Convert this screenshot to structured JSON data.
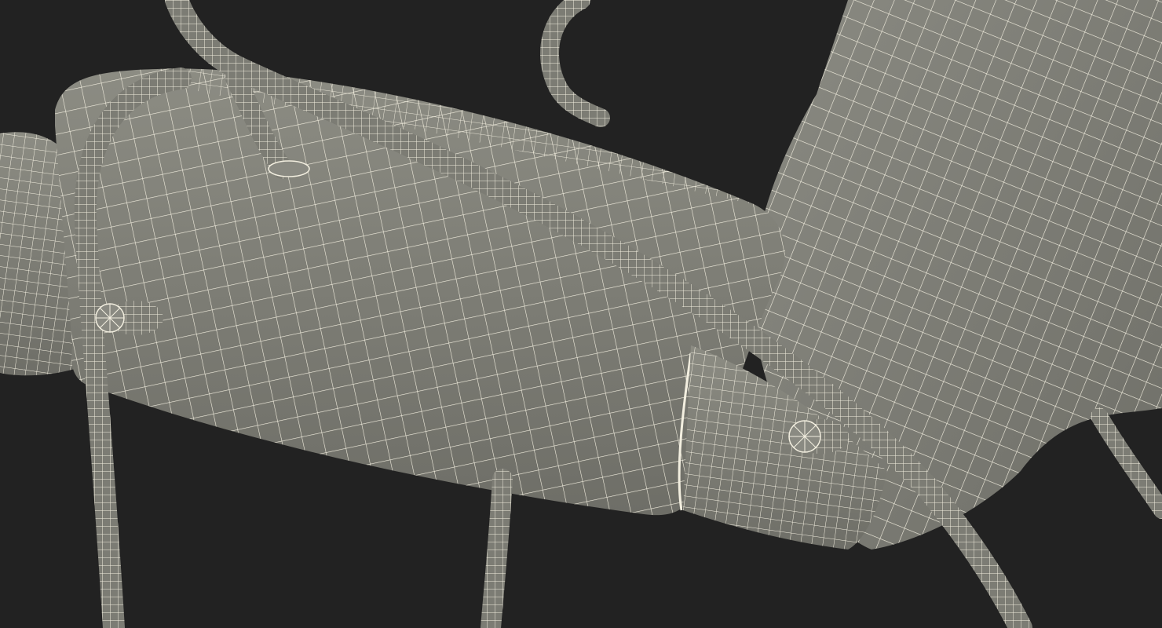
{
  "scene": {
    "background_color": "#222222",
    "surface_color": "#82827a",
    "wire_color": "#f3efe0"
  }
}
